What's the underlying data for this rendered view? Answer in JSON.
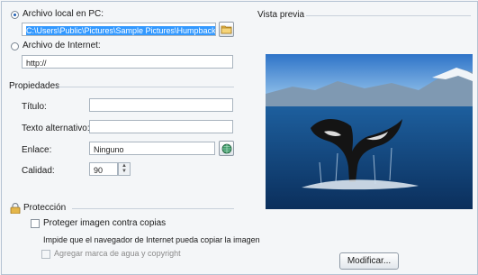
{
  "source": {
    "local_label": "Archivo local en PC:",
    "local_path": "C:\\Users\\Public\\Pictures\\Sample Pictures\\Humpback Whale.jpg",
    "internet_label": "Archivo de Internet:",
    "internet_value": "http://"
  },
  "preview": {
    "label": "Vista previa",
    "modify_button": "Modificar..."
  },
  "properties": {
    "section_label": "Propiedades",
    "title_label": "Título:",
    "title_value": "",
    "alt_label": "Texto alternativo:",
    "alt_value": "",
    "link_label": "Enlace:",
    "link_value": "Ninguno",
    "quality_label": "Calidad:",
    "quality_value": "90"
  },
  "protection": {
    "section_label": "Protección",
    "protect_label": "Proteger imagen contra copias",
    "protect_help": "Impide que el navegador de Internet pueda copiar la imagen",
    "watermark_label": "Agregar marca de agua y copyright"
  }
}
